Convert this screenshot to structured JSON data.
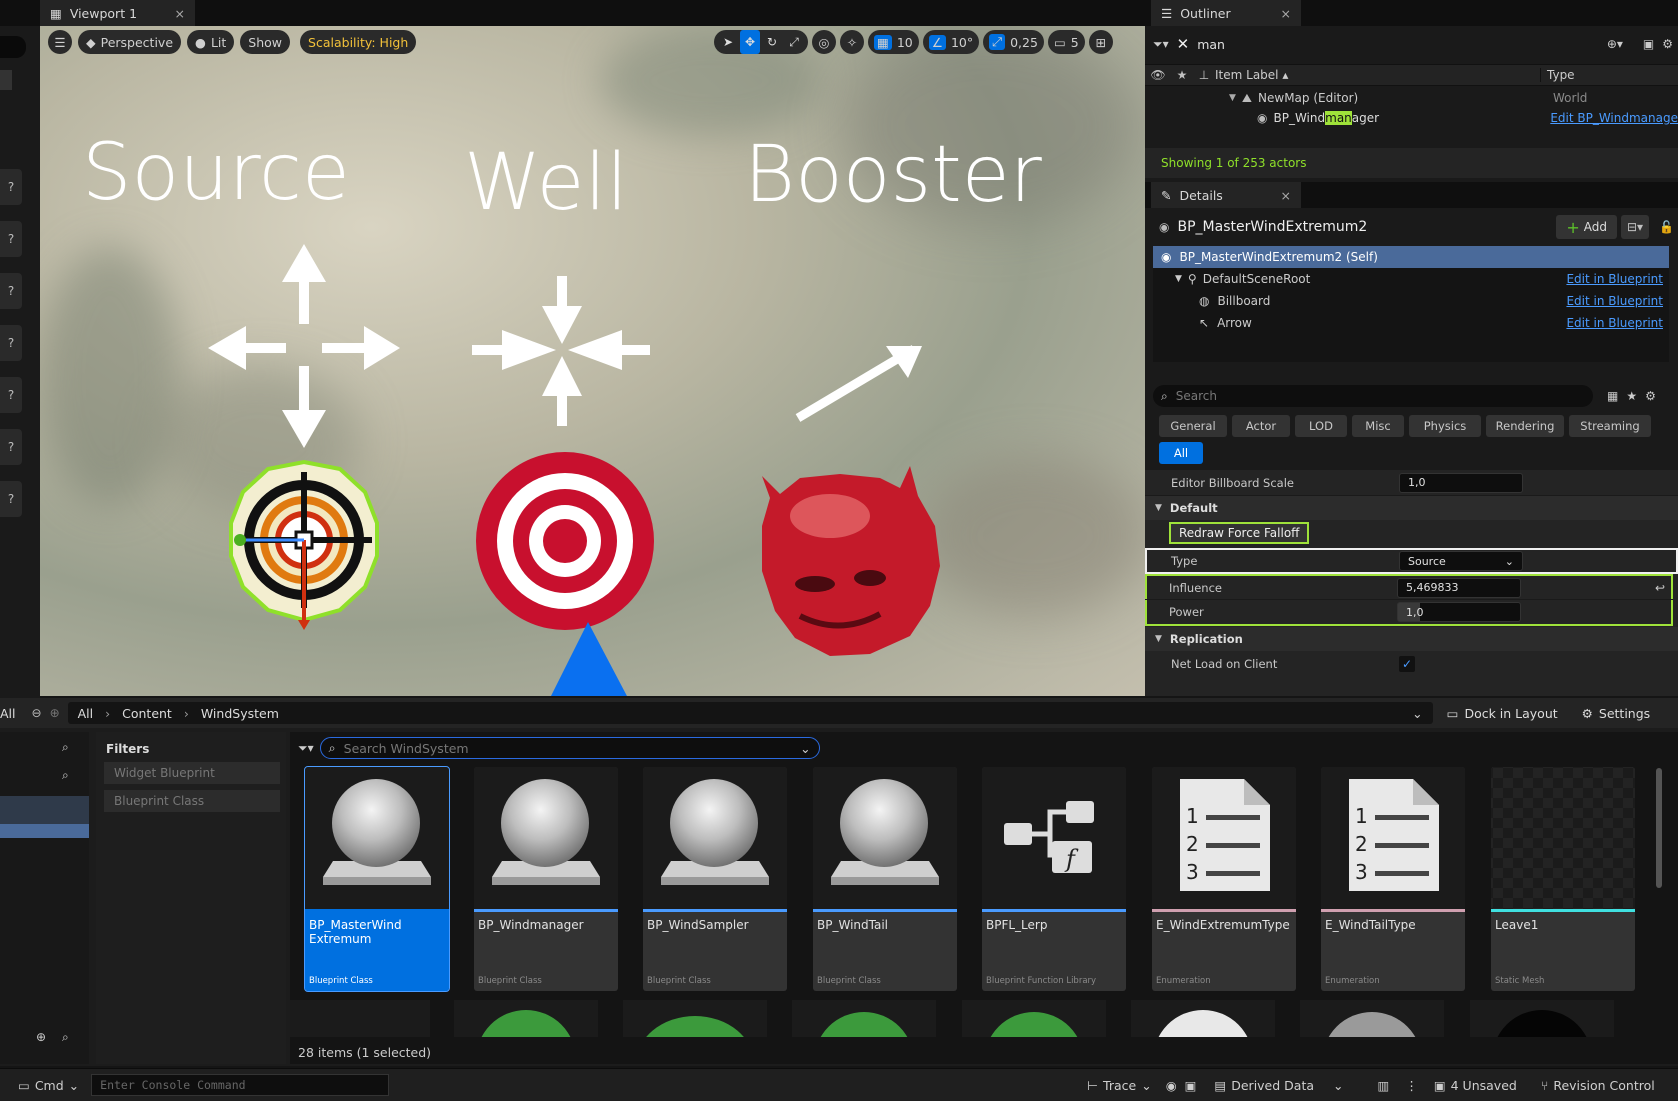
{
  "viewport": {
    "tab_title": "Viewport 1",
    "perspective": "Perspective",
    "lit": "Lit",
    "show": "Show",
    "scalability": "Scalability: High",
    "grid_value": "10",
    "angle_value": "10°",
    "scale_value": "0,25",
    "camera_speed": "5",
    "labels": {
      "source": "Source",
      "well": "Well",
      "booster": "Booster"
    }
  },
  "outliner": {
    "tab_title": "Outliner",
    "search_value": "man",
    "col_label": "Item Label",
    "col_type": "Type",
    "rows": [
      {
        "label": "NewMap (Editor)",
        "type": "World"
      },
      {
        "label_pre": "BP_Wind",
        "label_hl": "man",
        "label_post": "ager",
        "type": "Edit BP_Windmanage"
      }
    ],
    "status": "Showing 1 of 253 actors"
  },
  "details": {
    "tab_title": "Details",
    "object_name": "BP_MasterWindExtremum2",
    "add_label": "Add",
    "components": [
      {
        "label": "BP_MasterWindExtremum2 (Self)",
        "link": ""
      },
      {
        "label": "DefaultSceneRoot",
        "link": "Edit in Blueprint"
      },
      {
        "label": "Billboard",
        "link": "Edit in Blueprint"
      },
      {
        "label": "Arrow",
        "link": "Edit in Blueprint"
      }
    ],
    "search_placeholder": "Search",
    "categories": [
      "General",
      "Actor",
      "LOD",
      "Misc",
      "Physics",
      "Rendering",
      "Streaming",
      "All"
    ],
    "properties": {
      "billboard_scale": {
        "name": "Editor Billboard Scale",
        "value": "1,0"
      },
      "default_section": "Default",
      "redraw_button": "Redraw Force Falloff",
      "type": {
        "name": "Type",
        "value": "Source"
      },
      "influence": {
        "name": "Influence",
        "value": "5,469833"
      },
      "power": {
        "name": "Power",
        "value": "1,0"
      },
      "replication_section": "Replication",
      "net_load": {
        "name": "Net Load on Client",
        "checked": true
      }
    }
  },
  "content_browser": {
    "all_label": "All",
    "breadcrumb": [
      "All",
      "Content",
      "WindSystem"
    ],
    "dock_label": "Dock in Layout",
    "settings_label": "Settings",
    "filters_title": "Filters",
    "filters": [
      "Widget Blueprint",
      "Blueprint Class"
    ],
    "search_placeholder": "Search WindSystem",
    "assets": [
      {
        "name": "BP_MasterWind\nExtremum",
        "kind": "Blueprint Class",
        "icon": "sphere-icon",
        "bar": "#4a9bff",
        "selected": true
      },
      {
        "name": "BP_Windmanager",
        "kind": "Blueprint Class",
        "icon": "sphere-icon",
        "bar": "#4a9bff",
        "selected": false
      },
      {
        "name": "BP_WindSampler",
        "kind": "Blueprint Class",
        "icon": "sphere-icon",
        "bar": "#4a9bff",
        "selected": false
      },
      {
        "name": "BP_WindTail",
        "kind": "Blueprint Class",
        "icon": "sphere-icon",
        "bar": "#4a9bff",
        "selected": false
      },
      {
        "name": "BPFL_Lerp",
        "kind": "Blueprint Function Library",
        "icon": "function-library-icon",
        "bar": "#4a9bff",
        "selected": false
      },
      {
        "name": "E_WindExtremumType",
        "kind": "Enumeration",
        "icon": "enum-list-icon",
        "bar": "#d0a0b0",
        "selected": false
      },
      {
        "name": "E_WindTailType",
        "kind": "Enumeration",
        "icon": "enum-list-icon",
        "bar": "#d0a0b0",
        "selected": false
      },
      {
        "name": "Leave1",
        "kind": "Static Mesh",
        "icon": "mesh-thumbnail",
        "bar": "#40e0e0",
        "selected": false
      }
    ],
    "count": "28 items (1 selected)"
  },
  "statusbar": {
    "cmd": "Cmd",
    "console_placeholder": "Enter Console Command",
    "trace": "Trace",
    "derived_data": "Derived Data",
    "unsaved": "4 Unsaved",
    "revision_control": "Revision Control"
  },
  "colors": {
    "accent": "#0070e0",
    "highlight": "#9fe23a",
    "selection": "#4a6a9a"
  }
}
